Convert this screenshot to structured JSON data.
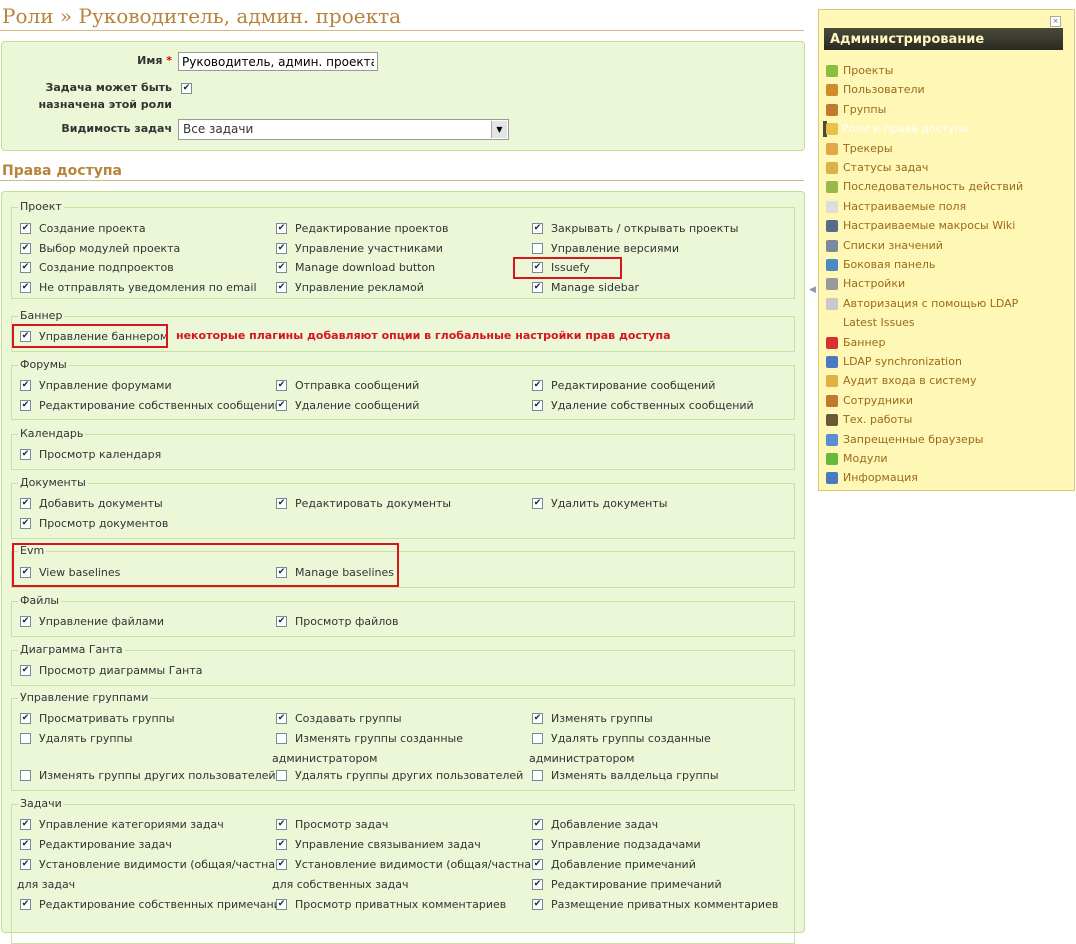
{
  "page": {
    "title": "Роли » Руководитель, админ. проекта"
  },
  "form": {
    "name_label": "Имя",
    "required_mark": "*",
    "name_value": "Руководитель, админ. проекта",
    "assignable_label_1": "Задача может быть",
    "assignable_label_2": "назначена этой роли",
    "assignable_checked": true,
    "visibility_label": "Видимость задач",
    "visibility_value": "Все задачи"
  },
  "permissions": {
    "heading": "Права доступа",
    "annotation_note": "некоторые плагины добавляют опции в глобальные настройки прав доступа",
    "groups": {
      "project": {
        "legend": "Проект",
        "items": [
          {
            "label": "Создание проекта",
            "checked": true
          },
          {
            "label": "Редактирование проектов",
            "checked": true
          },
          {
            "label": "Закрывать / открывать проекты",
            "checked": true
          },
          {
            "label": "Выбор модулей проекта",
            "checked": true
          },
          {
            "label": "Управление участниками",
            "checked": true
          },
          {
            "label": "Управление версиями",
            "checked": false
          },
          {
            "label": "Создание подпроектов",
            "checked": true
          },
          {
            "label": "Manage download button",
            "checked": true
          },
          {
            "label": "Issuefy",
            "checked": true
          },
          {
            "label": "Не отправлять уведомления по email",
            "checked": true
          },
          {
            "label": "Управление рекламой",
            "checked": true
          },
          {
            "label": "Manage sidebar",
            "checked": true
          }
        ]
      },
      "banner": {
        "legend": "Баннер",
        "items": [
          {
            "label": "Управление баннером",
            "checked": true
          }
        ]
      },
      "forums": {
        "legend": "Форумы",
        "items": [
          {
            "label": "Управление форумами",
            "checked": true
          },
          {
            "label": "Отправка сообщений",
            "checked": true
          },
          {
            "label": "Редактирование сообщений",
            "checked": true
          },
          {
            "label": "Редактирование собственных сообщений",
            "checked": true
          },
          {
            "label": "Удаление сообщений",
            "checked": true
          },
          {
            "label": "Удаление собственных сообщений",
            "checked": true
          }
        ]
      },
      "calendar": {
        "legend": "Календарь",
        "items": [
          {
            "label": "Просмотр календаря",
            "checked": true
          }
        ]
      },
      "documents": {
        "legend": "Документы",
        "items": [
          {
            "label": "Добавить документы",
            "checked": true
          },
          {
            "label": "Редактировать документы",
            "checked": true
          },
          {
            "label": "Удалить документы",
            "checked": true
          },
          {
            "label": "Просмотр документов",
            "checked": true
          }
        ]
      },
      "evm": {
        "legend": "Evm",
        "items": [
          {
            "label": "View baselines",
            "checked": true
          },
          {
            "label": "Manage baselines",
            "checked": true
          }
        ]
      },
      "files": {
        "legend": "Файлы",
        "items": [
          {
            "label": "Управление файлами",
            "checked": true
          },
          {
            "label": "Просмотр файлов",
            "checked": true
          }
        ]
      },
      "gantt": {
        "legend": "Диаграмма Ганта",
        "items": [
          {
            "label": "Просмотр диаграммы Ганта",
            "checked": true
          }
        ]
      },
      "groups_mgmt": {
        "legend": "Управление группами",
        "items": [
          {
            "label": "Просматривать группы",
            "checked": true
          },
          {
            "label": "Создавать группы",
            "checked": true
          },
          {
            "label": "Изменять группы",
            "checked": true
          },
          {
            "label": "Удалять группы",
            "checked": false
          },
          {
            "label": "Изменять группы созданные",
            "cont": "администратором",
            "checked": false
          },
          {
            "label": "Удалять группы созданные",
            "cont": "администратором",
            "checked": false
          },
          {
            "label": "Изменять группы других пользователей",
            "checked": false
          },
          {
            "label": "Удалять группы других пользователей",
            "checked": false
          },
          {
            "label": "Изменять валдельца группы",
            "checked": false
          }
        ]
      },
      "issues": {
        "legend": "Задачи",
        "items": [
          {
            "label": "Управление категориями задач",
            "checked": true
          },
          {
            "label": "Просмотр задач",
            "checked": true
          },
          {
            "label": "Добавление задач",
            "checked": true
          },
          {
            "label": "Редактирование задач",
            "checked": true
          },
          {
            "label": "Управление связыванием задач",
            "checked": true
          },
          {
            "label": "Управление подзадачами",
            "checked": true
          },
          {
            "label": "Установление видимости (общая/частная)",
            "cont": "для задач",
            "checked": true
          },
          {
            "label": "Установление видимости (общая/частная)",
            "cont": "для собственных задач",
            "checked": true
          },
          {
            "label": "Добавление примечаний",
            "checked": true
          },
          {
            "label": "Редактирование примечаний",
            "checked": true
          },
          {
            "label": "Редактирование собственных примечаний",
            "checked": true
          },
          {
            "label": "Просмотр приватных комментариев",
            "checked": true
          },
          {
            "label": "Размещение приватных комментариев",
            "checked": true
          }
        ]
      }
    }
  },
  "sidebar": {
    "title": "Администрирование",
    "close_glyph": "×",
    "items": [
      {
        "label": "Проекты",
        "icon": "projects-icon",
        "color": "#8bbf3f"
      },
      {
        "label": "Пользователи",
        "icon": "user-icon",
        "color": "#d08a2a"
      },
      {
        "label": "Группы",
        "icon": "group-icon",
        "color": "#c07a30"
      },
      {
        "label": "Роли и права доступа",
        "icon": "key-icon",
        "color": "#e8c14a",
        "selected": true
      },
      {
        "label": "Трекеры",
        "icon": "tracker-icon",
        "color": "#e0a84a"
      },
      {
        "label": "Статусы задач",
        "icon": "status-icon",
        "color": "#d9b24a"
      },
      {
        "label": "Последовательность действий",
        "icon": "workflow-icon",
        "color": "#9ab84a"
      },
      {
        "label": "Настраиваемые поля",
        "icon": "custom-fields-icon",
        "color": "#dddddd"
      },
      {
        "label": "Настраиваемые макросы Wiki",
        "icon": "wiki-macro-icon",
        "color": "#5a6a8a"
      },
      {
        "label": "Списки значений",
        "icon": "list-icon",
        "color": "#7a8a9a"
      },
      {
        "label": "Боковая панель",
        "icon": "sidebar-icon",
        "color": "#4a8ac0"
      },
      {
        "label": "Настройки",
        "icon": "gear-icon",
        "color": "#9a9a9a"
      },
      {
        "label": "Авторизация с помощью LDAP",
        "icon": "ldap-icon",
        "color": "#c8c8c8"
      },
      {
        "label": "Latest Issues",
        "icon": "",
        "color": ""
      },
      {
        "label": "Баннер",
        "icon": "banner-icon",
        "color": "#d83030"
      },
      {
        "label": "LDAP synchronization",
        "icon": "sync-icon",
        "color": "#4a7ac0"
      },
      {
        "label": "Аудит входа в систему",
        "icon": "audit-icon",
        "color": "#e0b040"
      },
      {
        "label": "Сотрудники",
        "icon": "employees-icon",
        "color": "#c07a30"
      },
      {
        "label": "Тех. работы",
        "icon": "hammer-icon",
        "color": "#6a5a3a"
      },
      {
        "label": "Запрещенные браузеры",
        "icon": "globe-icon",
        "color": "#5a90d0"
      },
      {
        "label": "Модули",
        "icon": "plugin-icon",
        "color": "#6ab83a"
      },
      {
        "label": "Информация",
        "icon": "info-icon",
        "color": "#4a7ac0"
      }
    ]
  }
}
